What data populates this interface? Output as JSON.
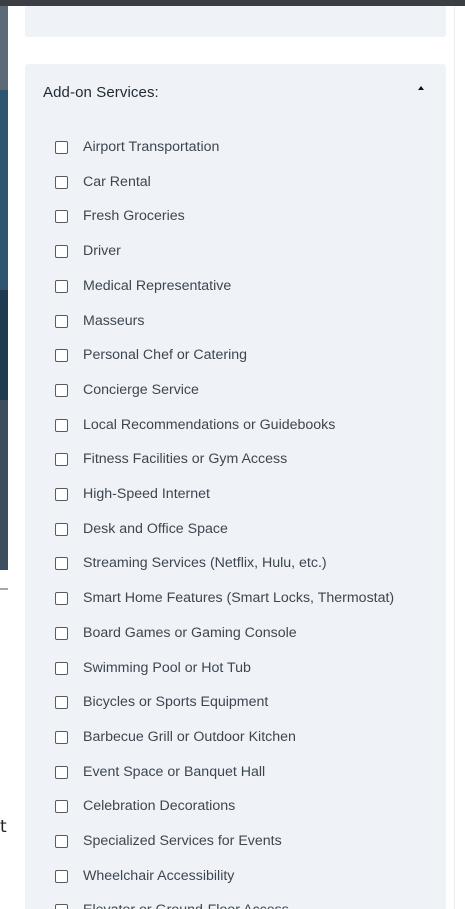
{
  "backdrop": {
    "partial_letter": "t"
  },
  "addons": {
    "title": "Add-on Services:",
    "expanded": true,
    "toggle_icon": "caret-up-icon",
    "options": [
      {
        "label": "Airport Transportation",
        "checked": false
      },
      {
        "label": "Car Rental",
        "checked": false
      },
      {
        "label": "Fresh Groceries",
        "checked": false
      },
      {
        "label": "Driver",
        "checked": false
      },
      {
        "label": "Medical Representative",
        "checked": false
      },
      {
        "label": "Masseurs",
        "checked": false
      },
      {
        "label": "Personal Chef or Catering",
        "checked": false
      },
      {
        "label": "Concierge Service",
        "checked": false
      },
      {
        "label": "Local Recommendations or Guidebooks",
        "checked": false
      },
      {
        "label": "Fitness Facilities or Gym Access",
        "checked": false
      },
      {
        "label": "High-Speed Internet",
        "checked": false
      },
      {
        "label": "Desk and Office Space",
        "checked": false
      },
      {
        "label": "Streaming Services (Netflix, Hulu, etc.)",
        "checked": false
      },
      {
        "label": "Smart Home Features (Smart Locks, Thermostat)",
        "checked": false
      },
      {
        "label": "Board Games or Gaming Console",
        "checked": false
      },
      {
        "label": "Swimming Pool or Hot Tub",
        "checked": false
      },
      {
        "label": "Bicycles or Sports Equipment",
        "checked": false
      },
      {
        "label": "Barbecue Grill or Outdoor Kitchen",
        "checked": false
      },
      {
        "label": "Event Space or Banquet Hall",
        "checked": false
      },
      {
        "label": "Celebration Decorations",
        "checked": false
      },
      {
        "label": "Specialized Services for Events",
        "checked": false
      },
      {
        "label": "Wheelchair Accessibility",
        "checked": false
      },
      {
        "label": "Elevator or Ground-Floor Access",
        "checked": false
      }
    ]
  }
}
